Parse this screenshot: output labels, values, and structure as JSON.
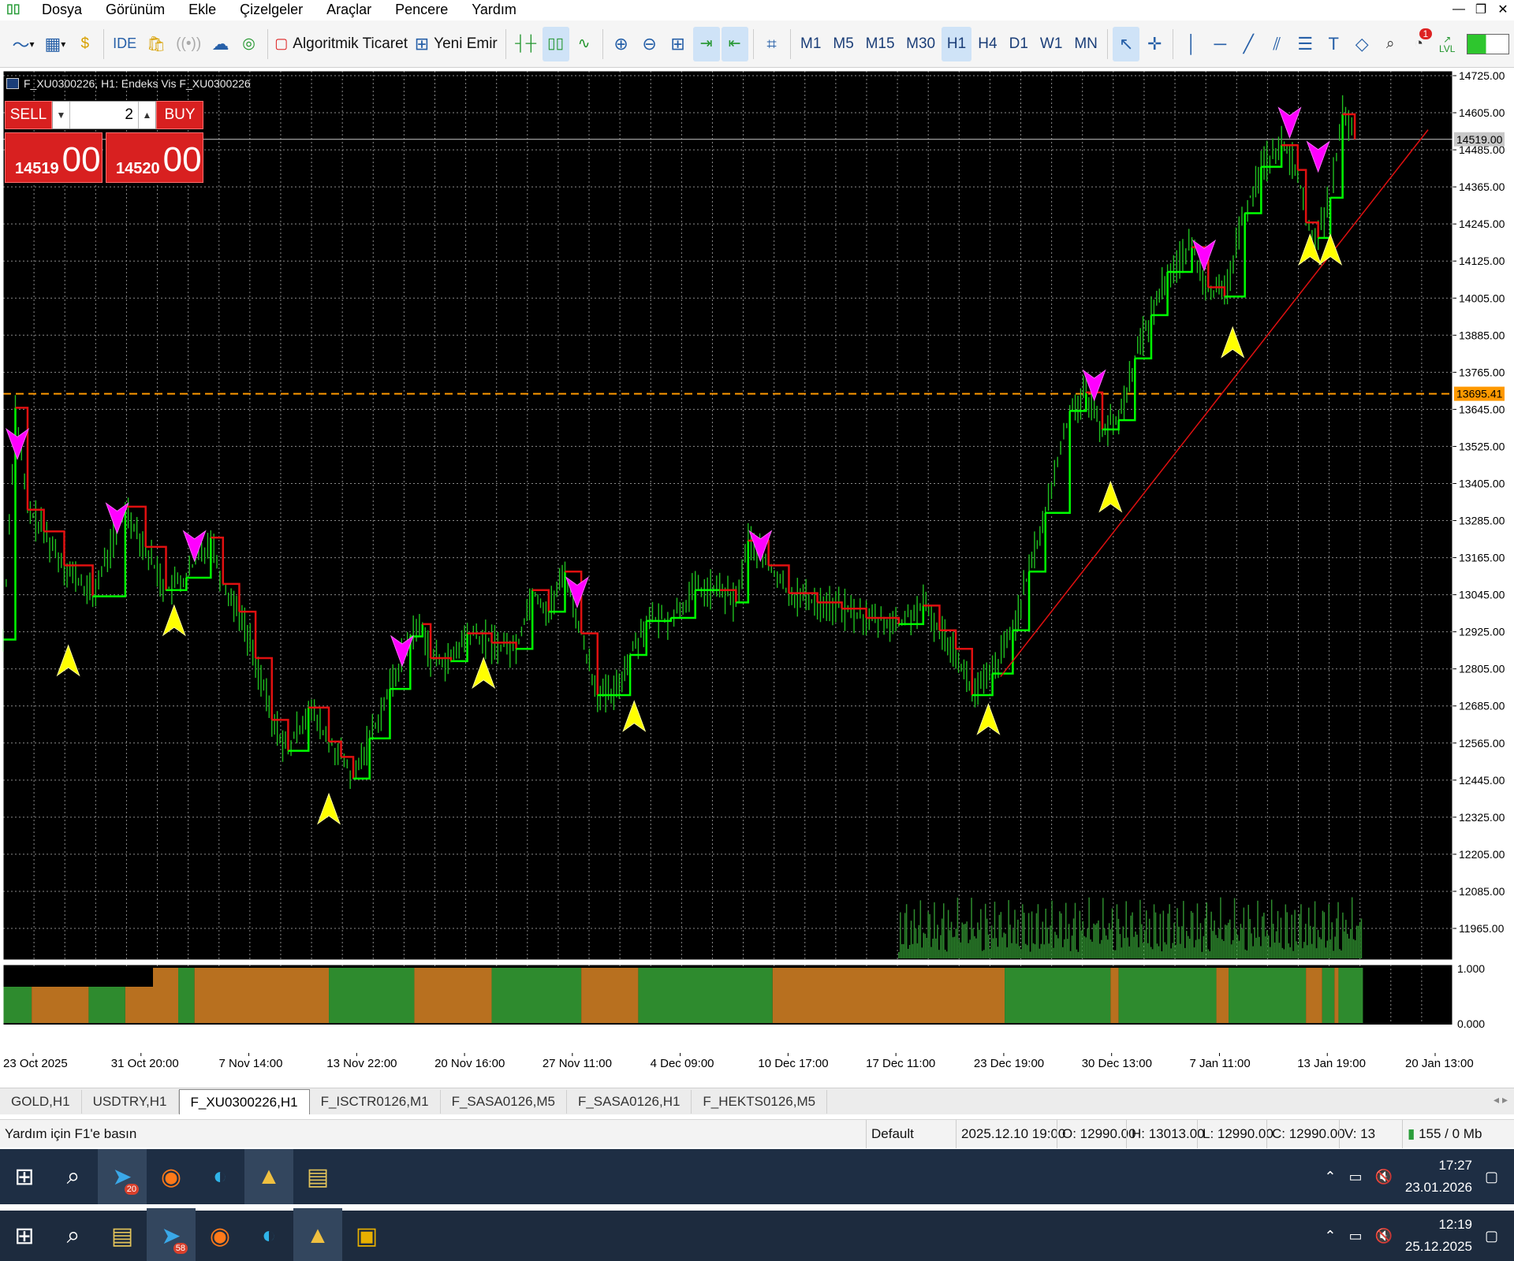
{
  "menu": {
    "items": [
      "Dosya",
      "Görünüm",
      "Ekle",
      "Çizelgeler",
      "Araçlar",
      "Pencere",
      "Yardım"
    ]
  },
  "toolbar": {
    "ide_label": "IDE",
    "algo_label": "Algoritmik Ticaret",
    "neworder_label": "Yeni Emir",
    "timeframes": [
      "M1",
      "M5",
      "M15",
      "M30",
      "H1",
      "H4",
      "D1",
      "W1",
      "MN"
    ],
    "active_timeframe": "H1",
    "notifications": "1",
    "lvl_label": "LVL"
  },
  "chart": {
    "title": "F_XU0300226, H1:  Endeks Vis F_XU0300226",
    "sell_label": "SELL",
    "buy_label": "BUY",
    "quantity": "2",
    "bid_small": "14519",
    "bid_large": "00",
    "ask_small": "14520",
    "ask_large": "00",
    "price_label_current": "14519.00",
    "price_label_level": "13695.41",
    "indicator_max": "1.000",
    "indicator_min": "0.000",
    "colors": {
      "background": "#000000",
      "grid": "#8a8a8a",
      "bull": "#1fbf1f",
      "bear": "#e01010",
      "trend": "#00ff00",
      "level": "#ff9900",
      "sell_signal": "#ff00ff",
      "buy_signal": "#ffff00",
      "hist_green": "#2e8b2e",
      "hist_orange": "#b8701f"
    }
  },
  "chart_data": {
    "type": "line",
    "symbol": "F_XU0300226",
    "timeframe": "H1",
    "price_axis": [
      "14725.00",
      "14605.00",
      "14485.00",
      "14365.00",
      "14245.00",
      "14125.00",
      "14005.00",
      "13885.00",
      "13765.00",
      "13645.00",
      "13525.00",
      "13405.00",
      "13285.00",
      "13165.00",
      "13045.00",
      "12925.00",
      "12805.00",
      "12685.00",
      "12565.00",
      "12445.00",
      "12325.00",
      "12205.00",
      "12085.00",
      "11965.00"
    ],
    "y_range": [
      11965,
      14725
    ],
    "time_axis": [
      "23 Oct 2025",
      "31 Oct 20:00",
      "7 Nov 14:00",
      "13 Nov 22:00",
      "20 Nov 16:00",
      "27 Nov 11:00",
      "4 Dec 09:00",
      "10 Dec 17:00",
      "17 Dec 11:00",
      "23 Dec 19:00",
      "30 Dec 13:00",
      "7 Jan 11:00",
      "13 Jan 19:00",
      "20 Jan 13:00"
    ],
    "level_line": 13695.41,
    "current_price": 14519.0,
    "price_path": [
      [
        0,
        12900
      ],
      [
        0.3,
        13650
      ],
      [
        0.6,
        13320
      ],
      [
        1.0,
        13250
      ],
      [
        1.5,
        13140
      ],
      [
        2.2,
        13040
      ],
      [
        3.0,
        13330
      ],
      [
        3.5,
        13200
      ],
      [
        4.0,
        13060
      ],
      [
        4.5,
        13100
      ],
      [
        5.1,
        13230
      ],
      [
        5.4,
        13080
      ],
      [
        5.8,
        12990
      ],
      [
        6.2,
        12840
      ],
      [
        6.6,
        12640
      ],
      [
        7.0,
        12540
      ],
      [
        7.5,
        12680
      ],
      [
        8.0,
        12570
      ],
      [
        8.3,
        12520
      ],
      [
        8.6,
        12450
      ],
      [
        9.0,
        12580
      ],
      [
        9.5,
        12740
      ],
      [
        10.0,
        12910
      ],
      [
        10.3,
        12950
      ],
      [
        10.5,
        12840
      ],
      [
        11.0,
        12830
      ],
      [
        11.4,
        12920
      ],
      [
        12.0,
        12890
      ],
      [
        12.6,
        12870
      ],
      [
        13.0,
        13060
      ],
      [
        13.4,
        12990
      ],
      [
        13.8,
        13120
      ],
      [
        14.2,
        12920
      ],
      [
        14.6,
        12720
      ],
      [
        15.0,
        12720
      ],
      [
        15.4,
        12850
      ],
      [
        15.8,
        12960
      ],
      [
        16.4,
        12970
      ],
      [
        17.0,
        13060
      ],
      [
        17.6,
        13060
      ],
      [
        18.0,
        13020
      ],
      [
        18.3,
        13220
      ],
      [
        18.8,
        13140
      ],
      [
        19.3,
        13050
      ],
      [
        20.0,
        13020
      ],
      [
        20.6,
        13000
      ],
      [
        21.2,
        12970
      ],
      [
        22.0,
        12950
      ],
      [
        22.6,
        13010
      ],
      [
        23.0,
        12930
      ],
      [
        23.4,
        12870
      ],
      [
        23.8,
        12720
      ],
      [
        24.3,
        12790
      ],
      [
        24.8,
        12930
      ],
      [
        25.2,
        13120
      ],
      [
        25.6,
        13310
      ],
      [
        26.2,
        13640
      ],
      [
        26.6,
        13700
      ],
      [
        27.0,
        13580
      ],
      [
        27.4,
        13610
      ],
      [
        27.8,
        13810
      ],
      [
        28.2,
        13950
      ],
      [
        28.6,
        14090
      ],
      [
        29.2,
        14170
      ],
      [
        29.6,
        14040
      ],
      [
        30.0,
        14010
      ],
      [
        30.5,
        14280
      ],
      [
        30.9,
        14430
      ],
      [
        31.4,
        14500
      ],
      [
        31.8,
        14420
      ],
      [
        32.0,
        14250
      ],
      [
        32.3,
        14200
      ],
      [
        32.6,
        14330
      ],
      [
        32.9,
        14600
      ],
      [
        33.2,
        14519
      ]
    ],
    "sell_signals": [
      [
        0.35,
        13520
      ],
      [
        2.8,
        13280
      ],
      [
        4.7,
        13190
      ],
      [
        9.8,
        12850
      ],
      [
        14.1,
        13040
      ],
      [
        18.6,
        13190
      ],
      [
        26.8,
        13710
      ],
      [
        29.5,
        14130
      ],
      [
        31.6,
        14560
      ],
      [
        32.3,
        14450
      ]
    ],
    "buy_signals": [
      [
        1.6,
        12840
      ],
      [
        4.2,
        12970
      ],
      [
        8.0,
        12360
      ],
      [
        11.8,
        12800
      ],
      [
        15.5,
        12660
      ],
      [
        24.2,
        12650
      ],
      [
        27.2,
        13370
      ],
      [
        30.2,
        13870
      ],
      [
        32.1,
        14170
      ],
      [
        32.6,
        14170
      ]
    ],
    "trend_line": [
      [
        24.5,
        12780
      ],
      [
        35,
        14550
      ]
    ],
    "indicator": {
      "type": "histogram",
      "ylim": [
        0,
        1
      ],
      "segments": [
        [
          "green",
          0,
          0.7
        ],
        [
          "orange",
          0.7,
          2.1
        ],
        [
          "green",
          2.1,
          3.0
        ],
        [
          "orange",
          3.0,
          4.3
        ],
        [
          "green",
          4.3,
          4.7
        ],
        [
          "orange",
          4.7,
          8.0
        ],
        [
          "green",
          8.0,
          10.1
        ],
        [
          "orange",
          10.1,
          12.0
        ],
        [
          "green",
          12.0,
          14.2
        ],
        [
          "orange",
          14.2,
          15.6
        ],
        [
          "green",
          15.6,
          18.9
        ],
        [
          "orange",
          18.9,
          24.6
        ],
        [
          "green",
          24.6,
          27.2
        ],
        [
          "orange",
          27.2,
          27.4
        ],
        [
          "green",
          27.4,
          29.8
        ],
        [
          "orange",
          29.8,
          30.1
        ],
        [
          "green",
          30.1,
          32.0
        ],
        [
          "orange",
          32.0,
          32.4
        ],
        [
          "green",
          32.4,
          32.7
        ],
        [
          "orange",
          32.7,
          32.8
        ],
        [
          "green",
          32.8,
          33.4
        ]
      ]
    }
  },
  "tabs": [
    "GOLD,H1",
    "USDTRY,H1",
    "F_XU0300226,H1",
    "F_ISCTR0126,M1",
    "F_SASA0126,M5",
    "F_SASA0126,H1",
    "F_HEKTS0126,M5"
  ],
  "active_tab": "F_XU0300226,H1",
  "status": {
    "help": "Yardım için F1'e basın",
    "profile": "Default",
    "datetime": "2025.12.10 19:00",
    "open": "O: 12990.00",
    "high": "H: 13013.00",
    "low": "L: 12990.00",
    "close": "C: 12990.00",
    "volume": "V: 13",
    "traffic": "155 / 0 Mb"
  },
  "taskbar1": {
    "time": "17:27",
    "date": "23.01.2026",
    "badge_telegram": "20"
  },
  "taskbar2": {
    "time": "12:19",
    "date": "25.12.2025",
    "badge_telegram": "58"
  }
}
